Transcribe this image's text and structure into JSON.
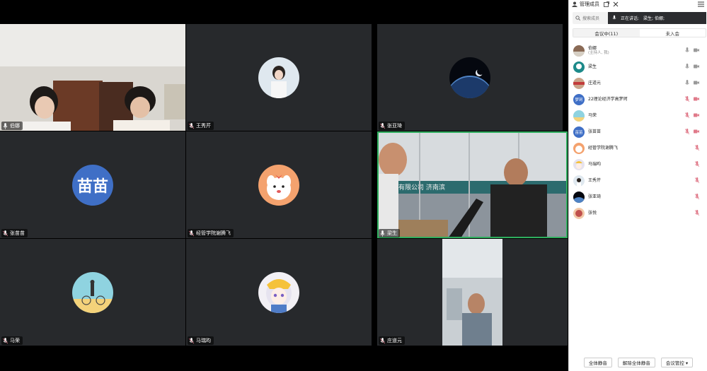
{
  "panel": {
    "title": "管理成员",
    "search_placeholder": "搜索成员",
    "speaking_label": "正在讲话:",
    "speaking_names": "梁生; 伯娜;",
    "tabs": [
      {
        "label": "会议中(11)",
        "selected": true
      },
      {
        "label": "未入会",
        "selected": false
      }
    ],
    "members": [
      {
        "name": "伯娜",
        "sub": "(主持人, 我)",
        "avatar": "photo-avatar"
      },
      {
        "name": "梁生",
        "sub": "",
        "avatar": "photo-avatar"
      },
      {
        "name": "庄道元",
        "sub": "",
        "avatar": "photo-avatar"
      },
      {
        "name": "22理论经济学高梦珂",
        "sub": "",
        "avatar": "text-avatar",
        "avatar_text": "梦珂"
      },
      {
        "name": "马荣",
        "sub": "",
        "avatar": "photo-avatar"
      },
      {
        "name": "张苗苗",
        "sub": "",
        "avatar": "text-avatar",
        "avatar_text": "苗苗"
      },
      {
        "name": "经管学院谢腾飞",
        "sub": "",
        "avatar": "photo-avatar"
      },
      {
        "name": "马瑞昀",
        "sub": "",
        "avatar": "photo-avatar"
      },
      {
        "name": "王秀芹",
        "sub": "",
        "avatar": "photo-avatar"
      },
      {
        "name": "张亚琦",
        "sub": "",
        "avatar": "photo-avatar"
      },
      {
        "name": "张悦",
        "sub": "",
        "avatar": "photo-avatar"
      }
    ],
    "footer": {
      "mute_all": "全体静音",
      "unmute_all": "解除全体静音",
      "meeting_control": "会议管控 ▾"
    }
  },
  "tiles": [
    {
      "name": "伯娜"
    },
    {
      "name": "王秀芹"
    },
    {
      "name": "张亚琦"
    },
    {
      "name": "张苗苗",
      "avatar_text": "苗苗"
    },
    {
      "name": "经管学院谢腾飞"
    },
    {
      "name": "梁生"
    },
    {
      "name": "马荣"
    },
    {
      "name": "马瑞昀"
    },
    {
      "name": "庄道元"
    }
  ],
  "colors": {
    "active_border": "#2fae5e",
    "text_avatar": "#3f6fc6",
    "muted_mic": "#e07a8a"
  }
}
